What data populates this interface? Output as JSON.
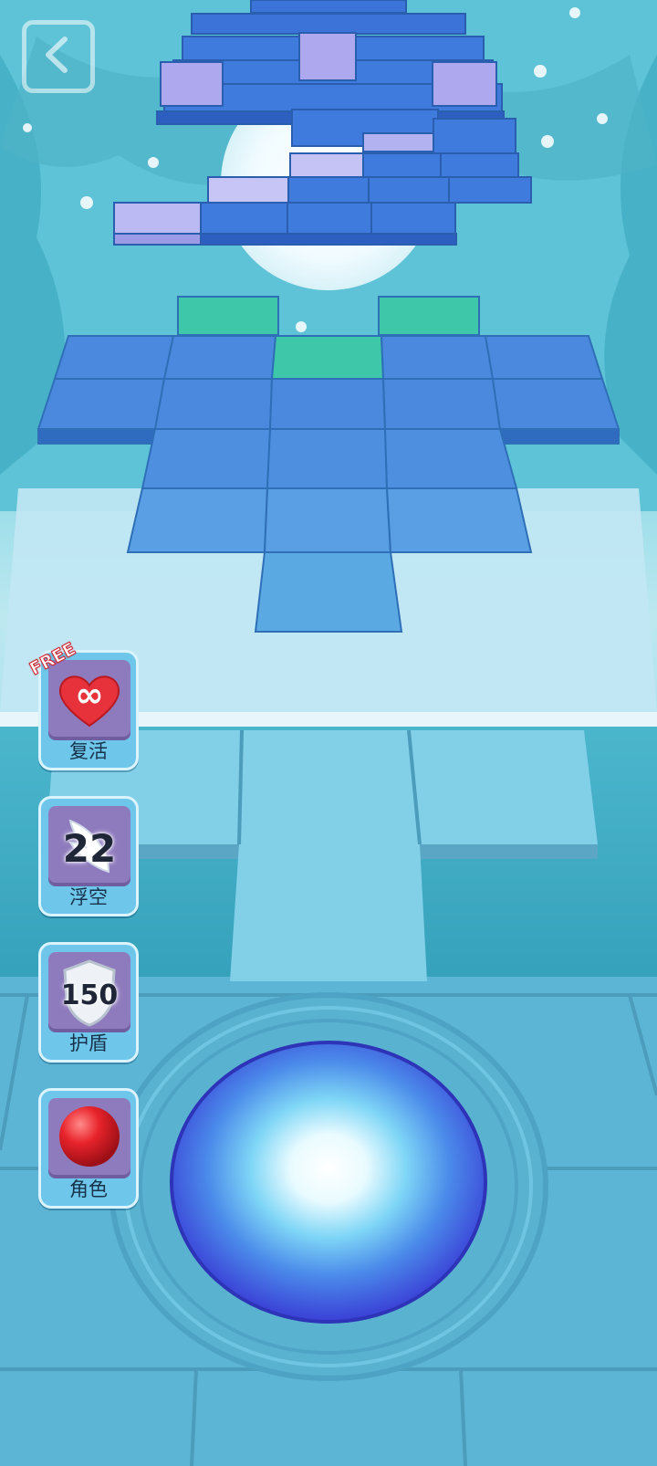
{
  "navigation": {
    "back_icon": "chevron-left-icon"
  },
  "powerups": [
    {
      "id": "revive",
      "label": "复活",
      "count": "∞",
      "badge": "FREE",
      "icon": "heart-icon"
    },
    {
      "id": "float",
      "label": "浮空",
      "count": "22",
      "icon": "feather-icon"
    },
    {
      "id": "shield",
      "label": "护盾",
      "count": "150",
      "icon": "shield-icon"
    },
    {
      "id": "character",
      "label": "角色",
      "icon": "red-ball-icon"
    }
  ],
  "colors": {
    "tile_blue": "#3f7fdc",
    "tile_green": "#3ec7a9",
    "tile_lavender": "#a9a3ef",
    "panel_bg": "#6ec6ea",
    "panel_box": "#8e7bbd",
    "free_badge": "#d3202c"
  }
}
